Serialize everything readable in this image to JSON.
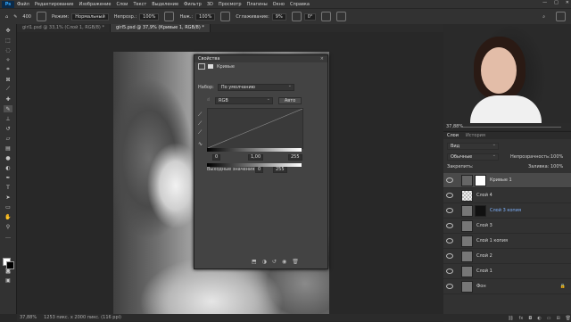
{
  "menu": {
    "logo": "Ps",
    "items": [
      "Файл",
      "Редактирование",
      "Изображение",
      "Слои",
      "Текст",
      "Выделение",
      "Фильтр",
      "3D",
      "Просмотр",
      "Плагины",
      "Окно",
      "Справка"
    ]
  },
  "options": {
    "brush_size": "400",
    "mode_label": "Режим:",
    "mode_value": "Нормальный",
    "opacity_label": "Непрозр.:",
    "opacity_value": "100%",
    "flow_label": "Наж.:",
    "flow_value": "100%",
    "smoothing_label": "Сглаживание:",
    "smoothing_value": "9%",
    "angle_value": "0°"
  },
  "tabs": [
    {
      "label": "girl1.psd @ 33,1% (Слой 1, RGB/8) *"
    },
    {
      "label": "girl5.psd @ 37,9% (Кривые 1, RGB/8) *"
    }
  ],
  "properties": {
    "title": "Свойства",
    "adjustment": "Кривые",
    "preset_label": "Набор:",
    "preset_value": "По умолчанию",
    "channel": "RGB",
    "auto_button": "Авто",
    "input_black": "0",
    "input_gamma": "1,00",
    "input_white": "255",
    "output_label": "Выходные значения:",
    "output_black": "0",
    "output_white": "255"
  },
  "layers_panel": {
    "tabs": [
      "Слои",
      "История"
    ],
    "search_placeholder": "Вид",
    "blend_mode": "Обычные",
    "opacity_label": "Непрозрачность:",
    "opacity_value": "100%",
    "lock_label": "Закрепить:",
    "fill_label": "Заливка:",
    "fill_value": "100%",
    "layers": [
      {
        "name": "Кривые 1",
        "selected": true,
        "kind": "adjustment"
      },
      {
        "name": "Слой 4",
        "selected": false,
        "kind": "empty"
      },
      {
        "name": "Слой 3 копия",
        "selected": false,
        "kind": "masked"
      },
      {
        "name": "Слой 3",
        "selected": false,
        "kind": "image"
      },
      {
        "name": "Слой 1 копия",
        "selected": false,
        "kind": "image"
      },
      {
        "name": "Слой 2",
        "selected": false,
        "kind": "image"
      },
      {
        "name": "Слой 1",
        "selected": false,
        "kind": "image"
      },
      {
        "name": "Фон",
        "selected": false,
        "kind": "image"
      }
    ]
  },
  "zoom_readout": "37,88%",
  "status": {
    "zoom": "37,88%",
    "doc_info": "1253 пикс. x 2000 пикс. (116 ppi)"
  }
}
